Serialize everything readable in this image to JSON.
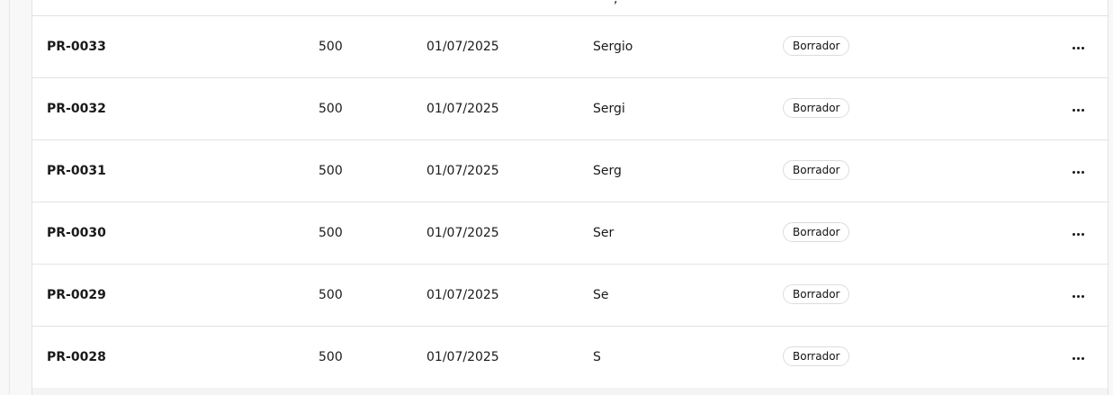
{
  "table": {
    "top_fragment": ",",
    "rows": [
      {
        "code": "PR-0033",
        "amount": "500",
        "date": "01/07/2025",
        "name": "Sergio",
        "status": "Borrador"
      },
      {
        "code": "PR-0032",
        "amount": "500",
        "date": "01/07/2025",
        "name": "Sergi",
        "status": "Borrador"
      },
      {
        "code": "PR-0031",
        "amount": "500",
        "date": "01/07/2025",
        "name": "Serg",
        "status": "Borrador"
      },
      {
        "code": "PR-0030",
        "amount": "500",
        "date": "01/07/2025",
        "name": "Ser",
        "status": "Borrador"
      },
      {
        "code": "PR-0029",
        "amount": "500",
        "date": "01/07/2025",
        "name": "Se",
        "status": "Borrador"
      },
      {
        "code": "PR-0028",
        "amount": "500",
        "date": "01/07/2025",
        "name": "S",
        "status": "Borrador"
      }
    ],
    "row_action_icon": "more-horizontal-icon"
  }
}
